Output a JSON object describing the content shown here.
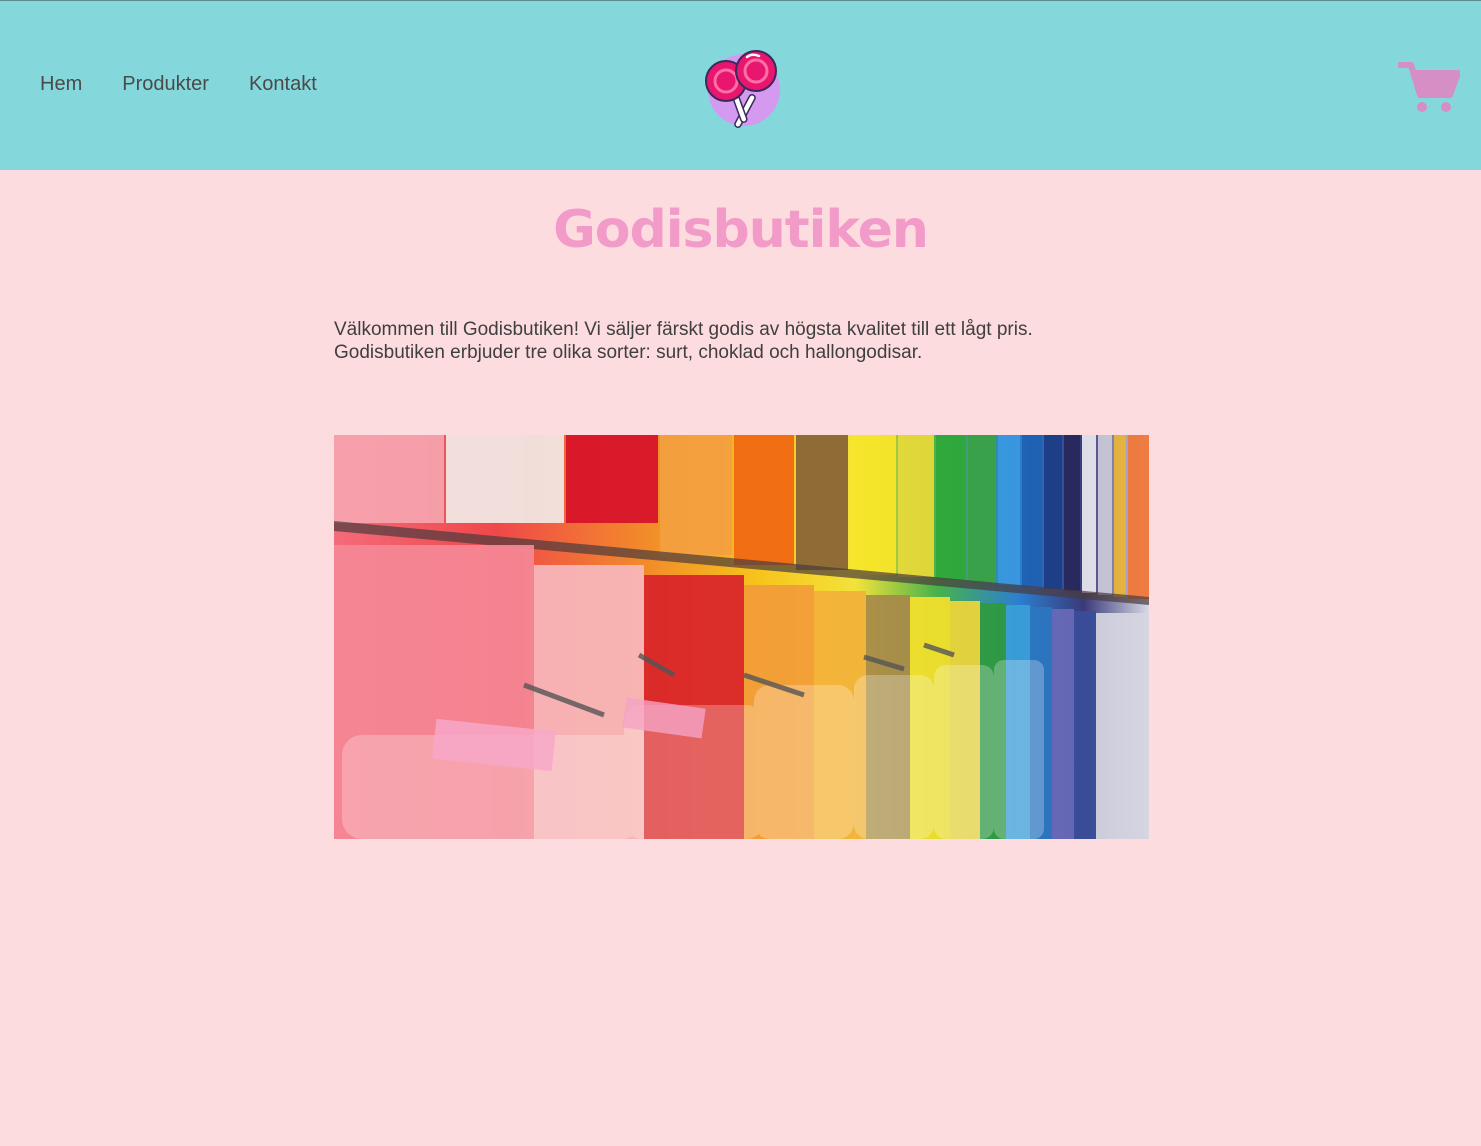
{
  "nav": {
    "items": [
      {
        "label": "Hem"
      },
      {
        "label": "Produkter"
      },
      {
        "label": "Kontakt"
      }
    ]
  },
  "logo": {
    "icon": "lollipop-logo-icon"
  },
  "cart": {
    "icon": "shopping-cart-icon"
  },
  "main": {
    "title": "Godisbutiken",
    "intro_line1": "Välkommen till Godisbutiken! Vi säljer färskt godis av högsta kvalitet till ett lågt pris.",
    "intro_line2": "Godisbutiken erbjuder tre olika sorter: surt, choklad och hallongodisar.",
    "image": {
      "depicts": "candy-wall-photo"
    }
  },
  "colors": {
    "header_bg": "#84d8dc",
    "page_bg": "#fddcdf",
    "title": "#f29ac8",
    "cart": "#d58fc4",
    "lollipop": "#e8166e"
  }
}
